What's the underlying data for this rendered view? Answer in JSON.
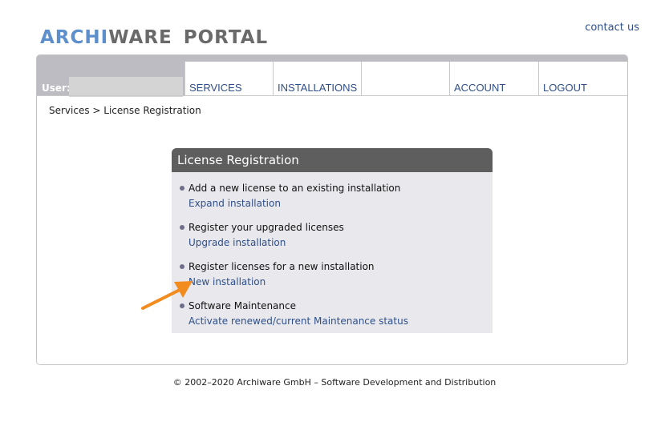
{
  "header": {
    "logo_part1": "ARCHI",
    "logo_part2": "WARE",
    "logo_part3": "PORTAL",
    "contact_label": "contact us"
  },
  "user": {
    "label": "User:",
    "value": ""
  },
  "nav": {
    "services": "SERVICES",
    "installations": "INSTALLATIONS",
    "account": "ACCOUNT",
    "logout": "LOGOUT"
  },
  "breadcrumb": "Services > License Registration",
  "card": {
    "title": "License Registration",
    "items": [
      {
        "title": "Add a new license to an existing installation",
        "link": "Expand installation"
      },
      {
        "title": "Register your upgraded licenses",
        "link": "Upgrade installation"
      },
      {
        "title": "Register licenses for a new installation",
        "link": "New installation"
      },
      {
        "title": "Software Maintenance",
        "link": "Activate renewed/current Maintenance status"
      }
    ]
  },
  "annotation": {
    "arrow_color": "#f28c1e"
  },
  "colors": {
    "brand_blue": "#5c8fcb",
    "link_blue": "#2e4f8a",
    "header_gray": "#5e5e5e",
    "card_bg": "#e9e9ed"
  },
  "footer": "© 2002–2020 Archiware GmbH – Software Development and Distribution"
}
